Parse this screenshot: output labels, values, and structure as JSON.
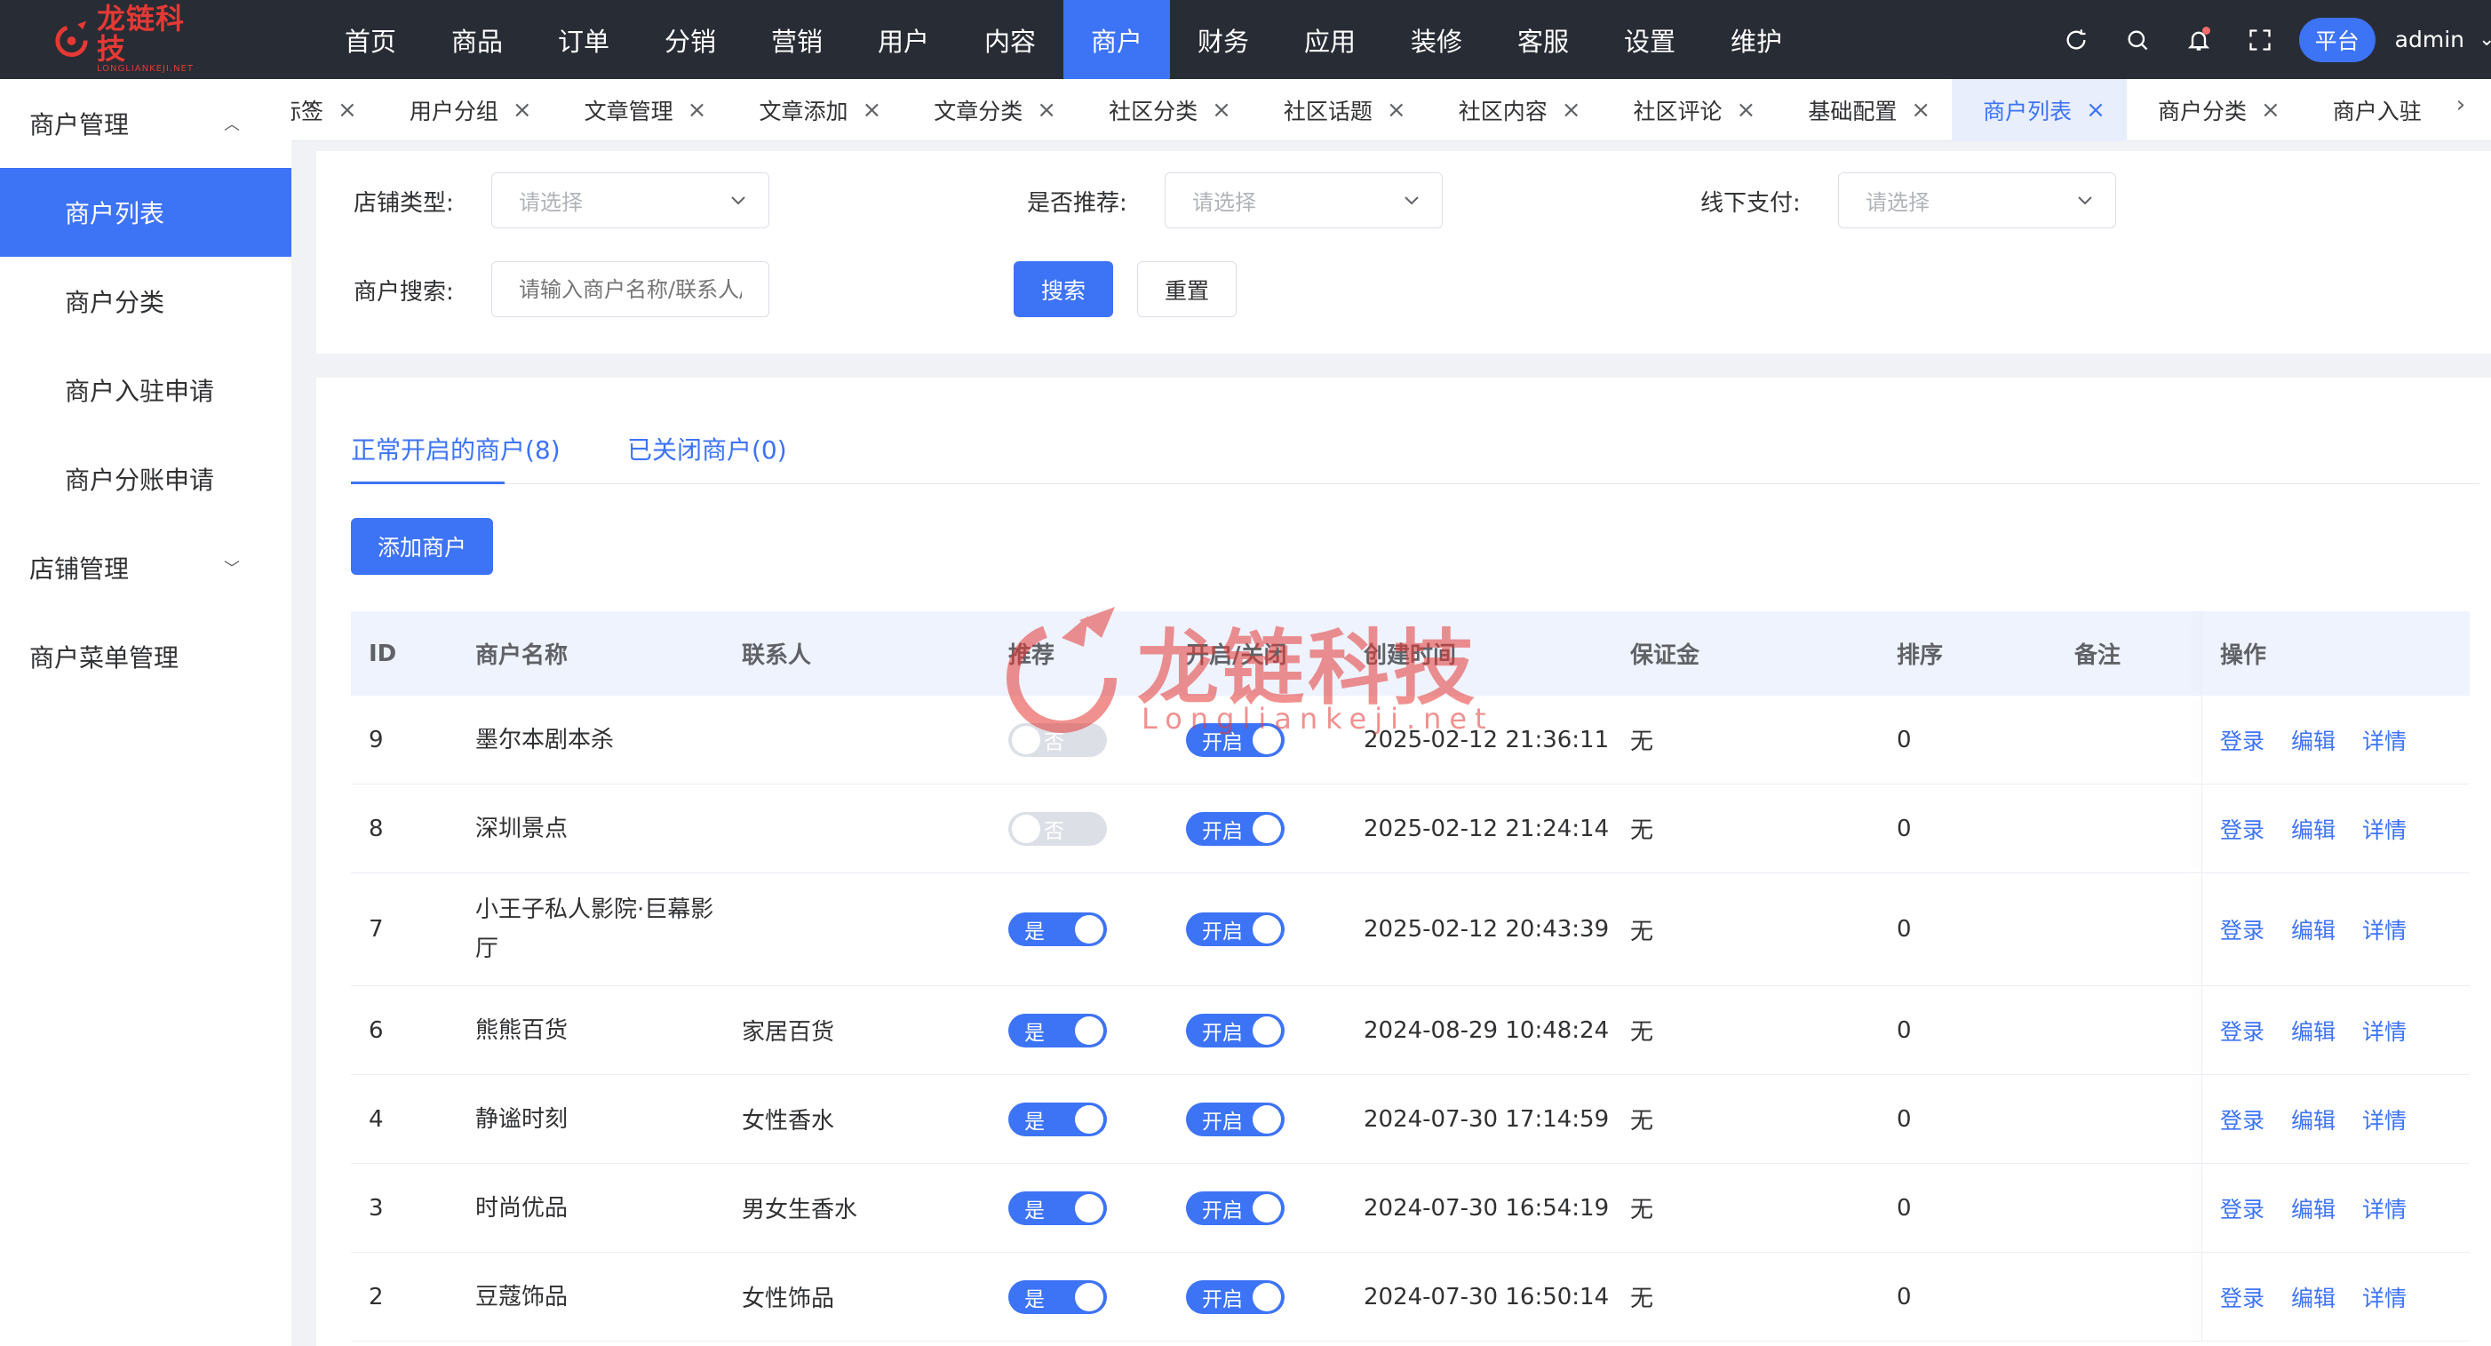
{
  "logo": {
    "title": "龙链科技",
    "subtitle": "LONGLIANKEJI.NET"
  },
  "topnav": {
    "items": [
      "首页",
      "商品",
      "订单",
      "分销",
      "营销",
      "用户",
      "内容",
      "商户",
      "财务",
      "应用",
      "装修",
      "客服",
      "设置",
      "维护"
    ],
    "active": "商户"
  },
  "header": {
    "platform_label": "平台",
    "user_name": "admin"
  },
  "sidebar": {
    "group1": "商户管理",
    "items": [
      "商户列表",
      "商户分类",
      "商户入驻申请",
      "商户分账申请"
    ],
    "group2": "店铺管理",
    "group3": "商户菜单管理"
  },
  "tabs": [
    "标签",
    "用户分组",
    "文章管理",
    "文章添加",
    "文章分类",
    "社区分类",
    "社区话题",
    "社区内容",
    "社区评论",
    "基础配置",
    "商户列表",
    "商户分类",
    "商户入驻申请"
  ],
  "tabs_active": "商户列表",
  "filters": {
    "shop_type_label": "店铺类型:",
    "shop_type_placeholder": "请选择",
    "recommend_label": "是否推荐:",
    "recommend_placeholder": "请选择",
    "offline_pay_label": "线下支付:",
    "offline_pay_placeholder": "请选择",
    "search_label": "商户搜索:",
    "search_placeholder": "请输入商户名称/联系人/联系电话",
    "search_button": "搜索",
    "reset_button": "重置"
  },
  "status_tabs": {
    "open": "正常开启的商户(8)",
    "closed": "已关闭商户(0)"
  },
  "add_button": "添加商户",
  "table": {
    "headers": [
      "ID",
      "商户名称",
      "联系人",
      "推荐",
      "开启/关闭",
      "创建时间",
      "保证金",
      "排序",
      "备注",
      "操作"
    ],
    "rows": [
      {
        "id": "9",
        "name": "墨尔本剧本杀",
        "contact": "",
        "recommend": false,
        "recommend_text": "否",
        "open_text": "开启",
        "created": "2025-02-12 21:36:11",
        "deposit": "无",
        "sort": "0",
        "note": ""
      },
      {
        "id": "8",
        "name": "深圳景点",
        "contact": "",
        "recommend": false,
        "recommend_text": "否",
        "open_text": "开启",
        "created": "2025-02-12 21:24:14",
        "deposit": "无",
        "sort": "0",
        "note": ""
      },
      {
        "id": "7",
        "name": "小王子私人影院·巨幕影厅",
        "contact": "",
        "recommend": true,
        "recommend_text": "是",
        "open_text": "开启",
        "created": "2025-02-12 20:43:39",
        "deposit": "无",
        "sort": "0",
        "note": ""
      },
      {
        "id": "6",
        "name": "熊熊百货",
        "contact": "家居百货",
        "recommend": true,
        "recommend_text": "是",
        "open_text": "开启",
        "created": "2024-08-29 10:48:24",
        "deposit": "无",
        "sort": "0",
        "note": ""
      },
      {
        "id": "4",
        "name": "静谧时刻",
        "contact": "女性香水",
        "recommend": true,
        "recommend_text": "是",
        "open_text": "开启",
        "created": "2024-07-30 17:14:59",
        "deposit": "无",
        "sort": "0",
        "note": ""
      },
      {
        "id": "3",
        "name": "时尚优品",
        "contact": "男女生香水",
        "recommend": true,
        "recommend_text": "是",
        "open_text": "开启",
        "created": "2024-07-30 16:54:19",
        "deposit": "无",
        "sort": "0",
        "note": ""
      },
      {
        "id": "2",
        "name": "豆蔻饰品",
        "contact": "女性饰品",
        "recommend": true,
        "recommend_text": "是",
        "open_text": "开启",
        "created": "2024-07-30 16:50:14",
        "deposit": "无",
        "sort": "0",
        "note": ""
      }
    ],
    "actions": [
      "登录",
      "编辑",
      "详情"
    ]
  },
  "watermark": {
    "title": "龙链科技",
    "subtitle": "Longliankeji.net"
  },
  "colors": {
    "primary": "#3d73f5",
    "topbar": "#282c34",
    "brand_red": "#e53935"
  }
}
